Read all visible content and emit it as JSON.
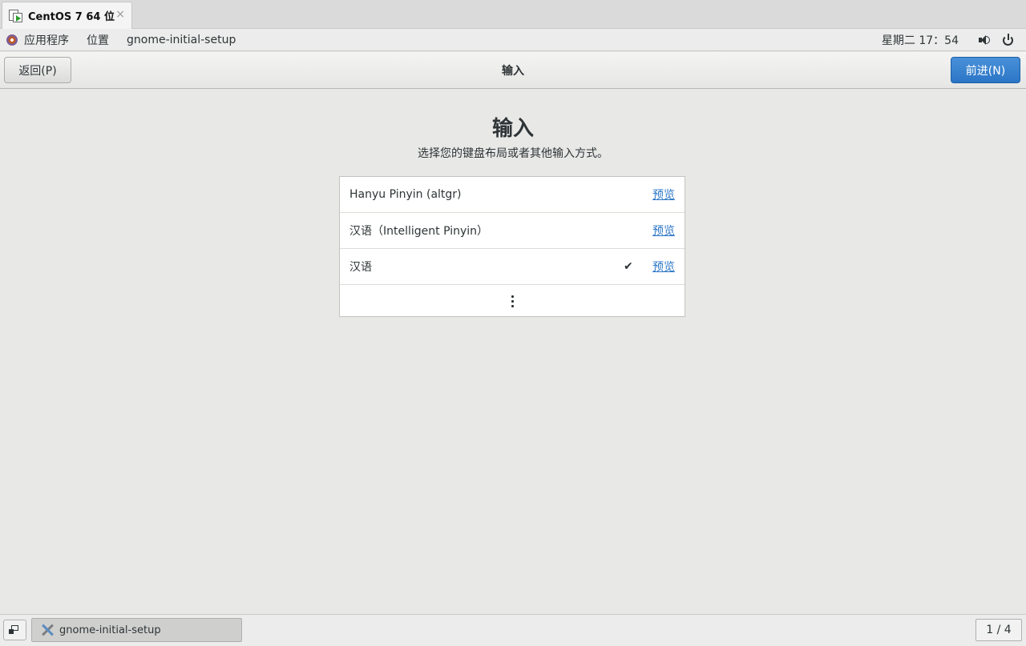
{
  "vm_tab": {
    "title": "CentOS 7 64 位",
    "close_glyph": "×"
  },
  "topbar": {
    "apps_label": "应用程序",
    "places_label": "位置",
    "app_name": "gnome-initial-setup",
    "clock": "星期二 17：54",
    "icons": [
      "gnome-foot-icon",
      "volume-icon",
      "power-icon"
    ]
  },
  "header": {
    "back_label": "返回(P)",
    "title": "输入",
    "next_label": "前进(N)"
  },
  "main": {
    "heading": "输入",
    "subtitle": "选择您的键盘布局或者其他输入方式。",
    "inputs": [
      {
        "label": "Hanyu Pinyin (altgr)",
        "selected": false,
        "preview": "预览"
      },
      {
        "label": "汉语（Intelligent Pinyin）",
        "selected": false,
        "preview": "预览"
      },
      {
        "label": "汉语",
        "selected": true,
        "check": "✔",
        "preview": "预览"
      }
    ],
    "more_icon": "view-more-icon"
  },
  "bottombar": {
    "task_label": "gnome-initial-setup",
    "workspace": "1 / 4"
  },
  "colors": {
    "accent": "#2a76c6",
    "background": "#e8e8e7",
    "text": "#2e3436"
  }
}
